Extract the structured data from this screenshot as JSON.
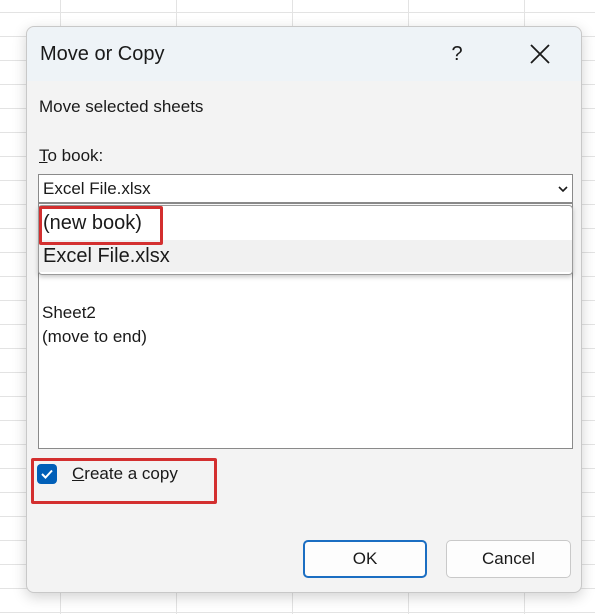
{
  "dialog": {
    "title": "Move or Copy",
    "help_label": "?",
    "description": "Move selected sheets",
    "to_book_label_access": "T",
    "to_book_label_rest": "o book:",
    "to_book_value": "Excel File.xlsx",
    "dropdown_options": [
      "(new book)",
      "Excel File.xlsx"
    ],
    "sheets": [
      "Sheet2",
      "(move to end)"
    ],
    "create_copy_access": "C",
    "create_copy_rest": "reate a copy",
    "create_copy_checked": true,
    "ok_label": "OK",
    "cancel_label": "Cancel"
  },
  "colors": {
    "accent": "#005fb8",
    "highlight": "#d32f2f"
  },
  "icons": {
    "help": "question-mark-icon",
    "close": "close-icon",
    "dropdown": "chevron-down-icon",
    "check": "checkmark-icon"
  }
}
